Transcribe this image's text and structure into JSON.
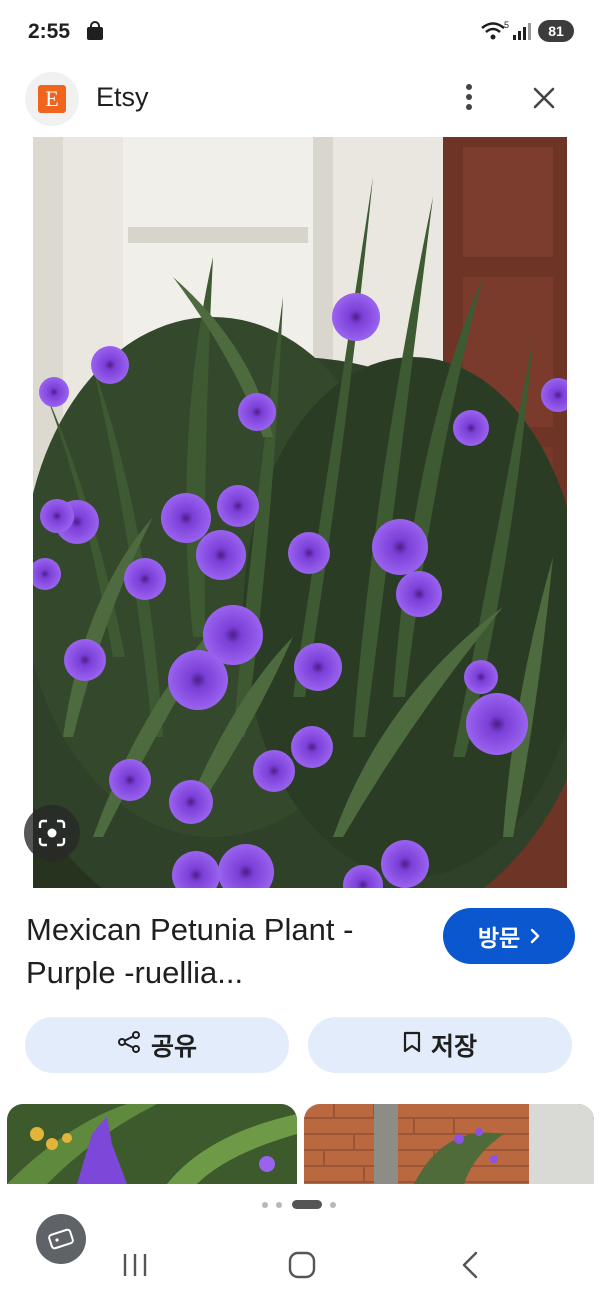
{
  "status_bar": {
    "time": "2:55",
    "wifi_generation": "5",
    "battery": "81",
    "icons": [
      "shopping-bag-icon",
      "wifi-icon",
      "signal-icon",
      "battery-icon"
    ]
  },
  "header": {
    "logo_letter": "E",
    "site_name": "Etsy",
    "brand_color": "#f1641e"
  },
  "result": {
    "title": "Mexican Petunia Plant - Purple -ruellia...",
    "visit_label": "방문",
    "share_label": "공유",
    "save_label": "저장"
  },
  "colors": {
    "accent": "#0b57d0",
    "pill_background": "#e3ecfb",
    "flower": "#8b52e6"
  },
  "pager": {
    "count": 4,
    "active_index": 2
  }
}
